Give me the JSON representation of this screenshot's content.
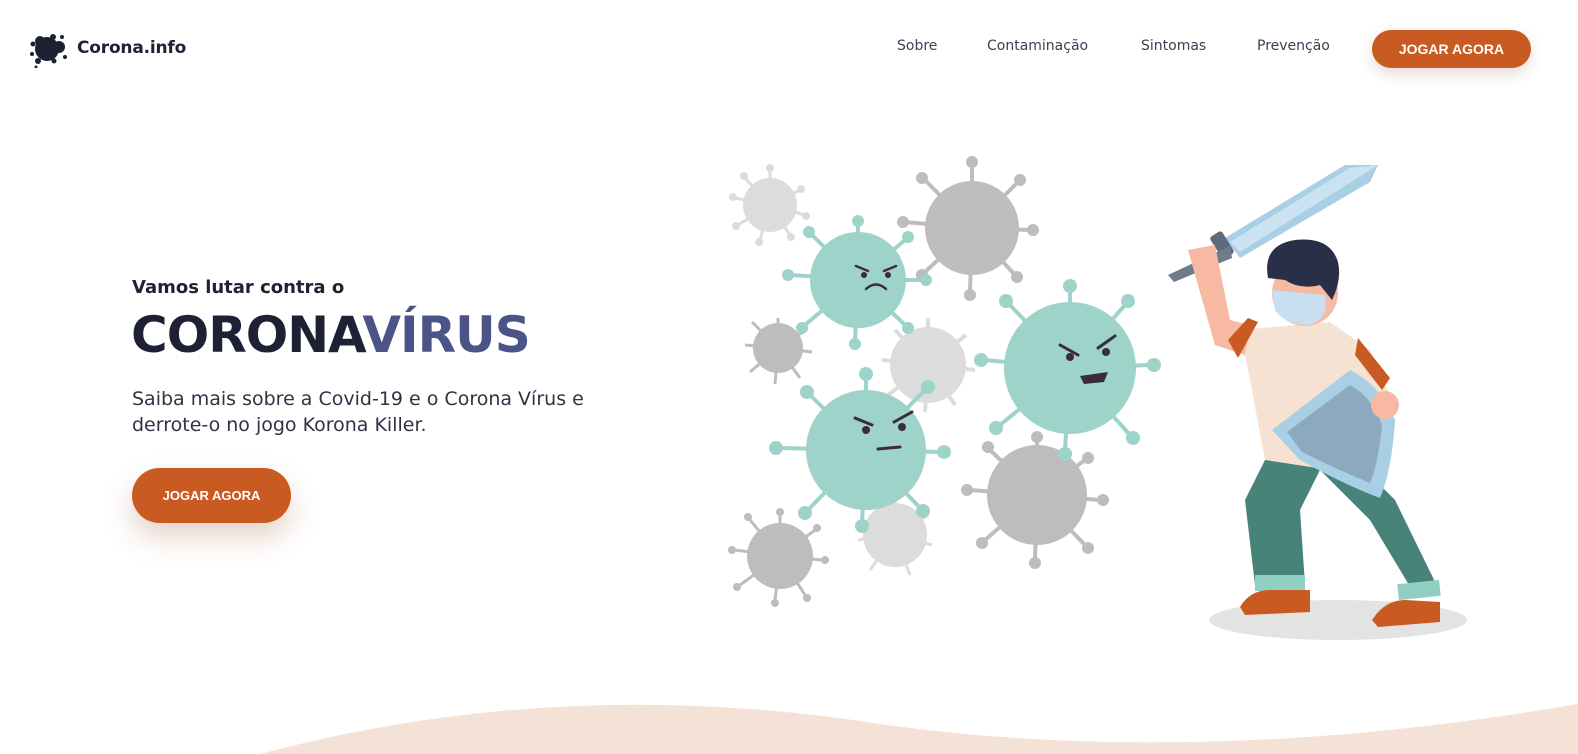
{
  "brand": {
    "name": "Corona.info",
    "icon": "virus-blob-icon"
  },
  "nav": {
    "items": [
      {
        "label": "Sobre"
      },
      {
        "label": "Contaminação"
      },
      {
        "label": "Sintomas"
      },
      {
        "label": "Prevenção"
      }
    ],
    "cta_label": "JOGAR AGORA"
  },
  "hero": {
    "subtitle": "Vamos lutar contra o",
    "title_part1": "CORONA",
    "title_part2": "VÍRUS",
    "description": "Saiba mais sobre a Covid-19 e o Corona Vírus e derrote-o no jogo Korona Killer.",
    "cta_label": "JOGAR AGORA"
  },
  "colors": {
    "accent": "#c95b22",
    "dark": "#1d2133",
    "title_secondary": "#4a5486",
    "virus_teal": "#9dd3c8",
    "virus_gray": "#bdbdbd",
    "wave": "#f5e2d6"
  }
}
